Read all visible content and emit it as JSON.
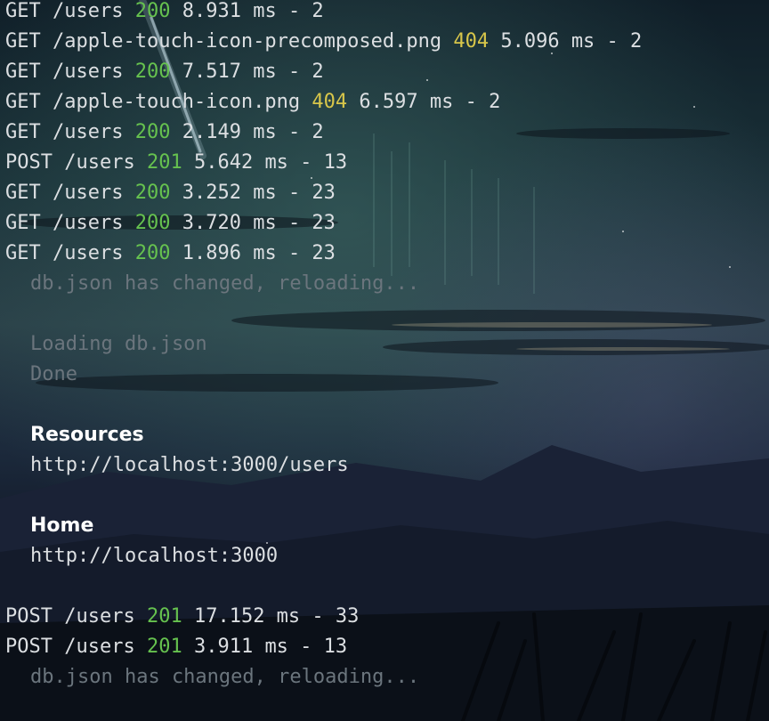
{
  "terminal": {
    "colors": {
      "text": "#dcdfe2",
      "status_2xx": "#66c24f",
      "status_4xx": "#d8c64a",
      "dim": "#6b757d",
      "heading": "#ffffff"
    },
    "requests_top": [
      {
        "method": "GET",
        "path": "/users",
        "status": "200",
        "time": "8.931 ms - 2"
      },
      {
        "method": "GET",
        "path": "/apple-touch-icon-precomposed.png",
        "status": "404",
        "time": "5.096 ms - 2"
      },
      {
        "method": "GET",
        "path": "/users",
        "status": "200",
        "time": "7.517 ms - 2"
      },
      {
        "method": "GET",
        "path": "/apple-touch-icon.png",
        "status": "404",
        "time": "6.597 ms - 2"
      },
      {
        "method": "GET",
        "path": "/users",
        "status": "200",
        "time": "2.149 ms - 2"
      },
      {
        "method": "POST",
        "path": "/users",
        "status": "201",
        "time": "5.642 ms - 13"
      },
      {
        "method": "GET",
        "path": "/users",
        "status": "200",
        "time": "3.252 ms - 23"
      },
      {
        "method": "GET",
        "path": "/users",
        "status": "200",
        "time": "3.720 ms - 23"
      },
      {
        "method": "GET",
        "path": "/users",
        "status": "200",
        "time": "1.896 ms - 23"
      }
    ],
    "reload_notice_1": "db.json has changed, reloading...",
    "loading_text": "Loading db.json",
    "done_text": "Done",
    "resources_heading": "Resources",
    "resources_url": "http://localhost:3000/users",
    "home_heading": "Home",
    "home_url": "http://localhost:3000",
    "requests_bottom": [
      {
        "method": "POST",
        "path": "/users",
        "status": "201",
        "time": "17.152 ms - 33"
      },
      {
        "method": "POST",
        "path": "/users",
        "status": "201",
        "time": "3.911 ms - 13"
      }
    ],
    "reload_notice_2": "db.json has changed, reloading..."
  }
}
